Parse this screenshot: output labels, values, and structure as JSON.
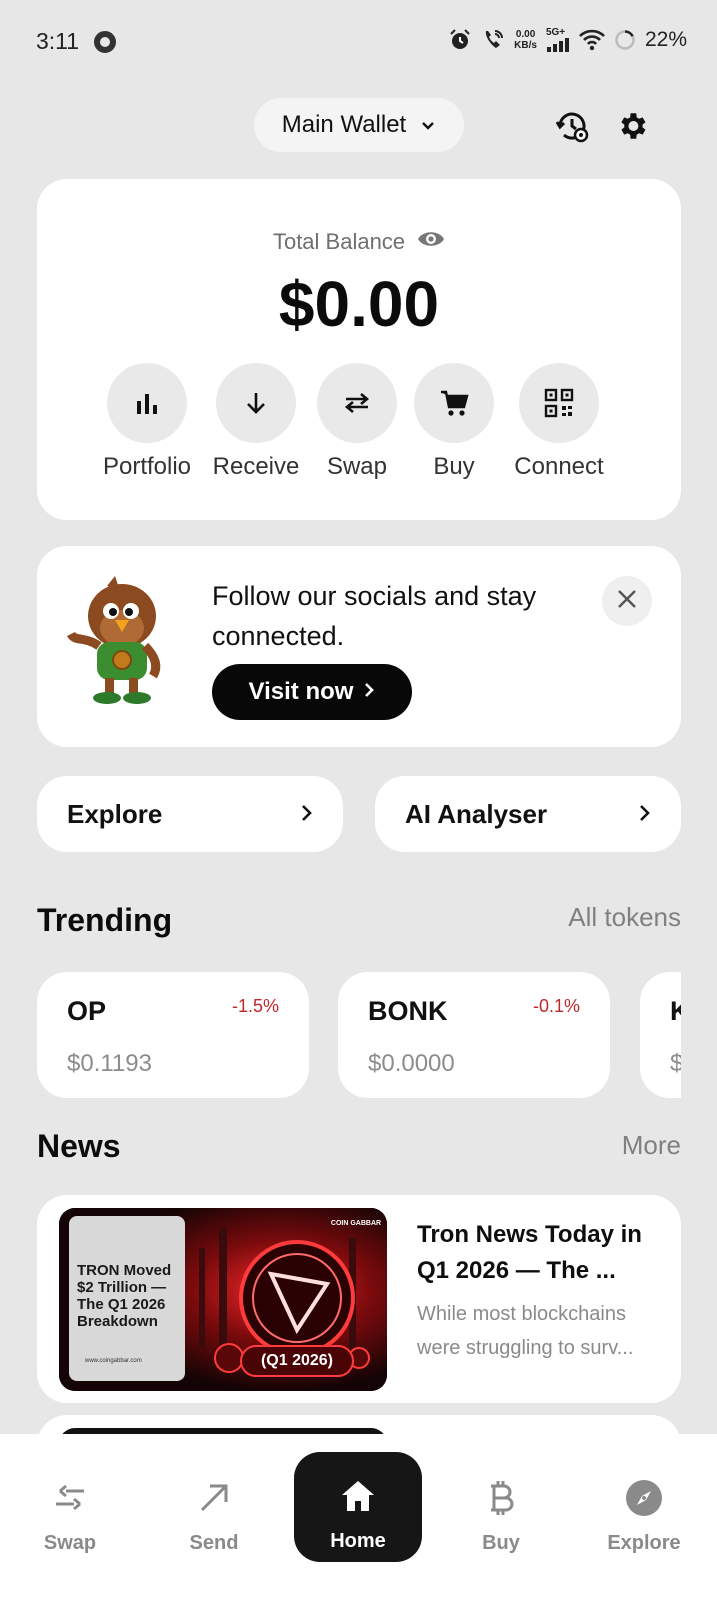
{
  "status_bar": {
    "time": "3:11",
    "net_speed_value": "0.00",
    "net_speed_unit": "KB/s",
    "network_type": "5G+",
    "battery": "22%"
  },
  "header": {
    "wallet_name": "Main Wallet"
  },
  "balance": {
    "label": "Total Balance",
    "value": "$0.00",
    "actions": [
      {
        "label": "Portfolio",
        "icon": "bar-chart-icon"
      },
      {
        "label": "Receive",
        "icon": "arrow-down-icon"
      },
      {
        "label": "Swap",
        "icon": "swap-icon"
      },
      {
        "label": "Buy",
        "icon": "cart-icon"
      },
      {
        "label": "Connect",
        "icon": "qr-scan-icon"
      }
    ]
  },
  "promo": {
    "text": "Follow our socials and stay connected.",
    "button": "Visit now"
  },
  "quick_links": [
    {
      "label": "Explore"
    },
    {
      "label": "AI Analyser"
    }
  ],
  "trending": {
    "title": "Trending",
    "link": "All tokens",
    "tokens": [
      {
        "symbol": "OP",
        "change": "-1.5%",
        "price": "$0.1193"
      },
      {
        "symbol": "BONK",
        "change": "-0.1%",
        "price": "$0.0000"
      },
      {
        "symbol": "K",
        "change": "",
        "price": "$"
      }
    ]
  },
  "news": {
    "title": "News",
    "link": "More",
    "items": [
      {
        "title": "Tron News Today in Q1 2026 — The ...",
        "description": "While most blockchains were struggling to surv...",
        "thumb_headline": "TRON Moved $2 Trillion — The Q1 2026 Breakdown",
        "thumb_badge": "(Q1 2026)",
        "thumb_brand": "COIN GABBAR",
        "thumb_url": "www.coingabbar.com"
      }
    ]
  },
  "bottom_nav": [
    {
      "label": "Swap",
      "icon": "swap-icon"
    },
    {
      "label": "Send",
      "icon": "send-arrow-icon"
    },
    {
      "label": "Home",
      "icon": "home-icon",
      "active": true
    },
    {
      "label": "Buy",
      "icon": "bitcoin-icon"
    },
    {
      "label": "Explore",
      "icon": "compass-icon"
    }
  ],
  "colors": {
    "background": "#e7e7e7",
    "card": "#ffffff",
    "negative": "#c0272d",
    "primary_button": "#080808",
    "muted_text": "#8a8a8a"
  }
}
